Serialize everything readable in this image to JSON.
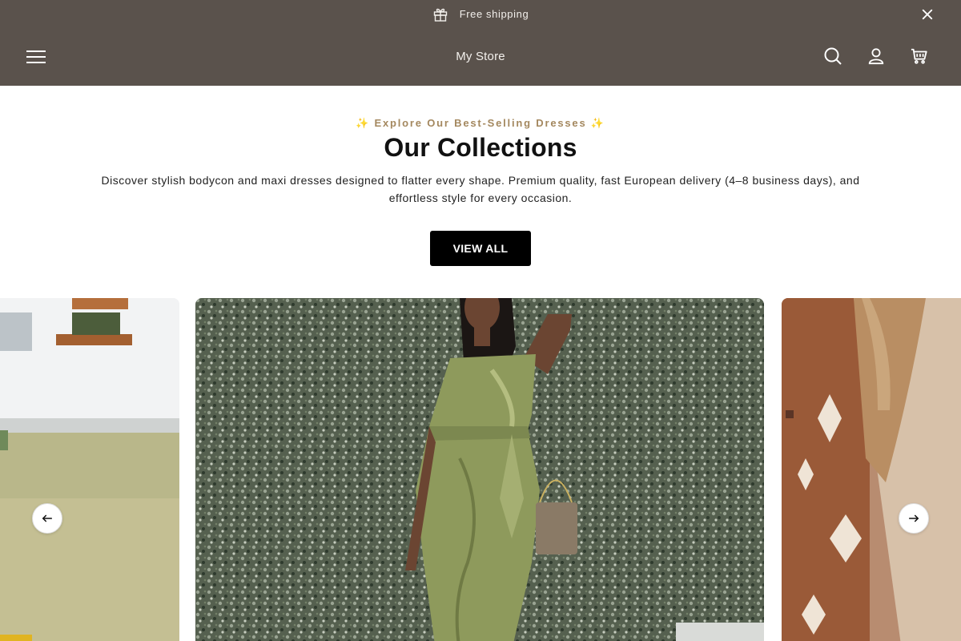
{
  "announcement": {
    "text": "Free shipping",
    "icon": "gift-icon",
    "close_icon": "close-icon"
  },
  "header": {
    "store_name": "My Store",
    "icons": [
      "menu-icon",
      "search-icon",
      "account-icon",
      "cart-icon"
    ],
    "background": "#5a524c"
  },
  "collections": {
    "eyebrow": "✨ Explore Our Best-Selling Dresses ✨",
    "title": "Our Collections",
    "description": "Discover stylish bodycon and maxi dresses designed to flatter every shape. Premium quality, fast European delivery (4–8 business days), and effortless style for every occasion.",
    "button_label": "VIEW ALL"
  },
  "carousel": {
    "slides": [
      {
        "name": "slide-previous",
        "image": "woman-in-yellow-dress-on-lawn"
      },
      {
        "name": "slide-current",
        "image": "woman-in-olive-satin-one-shoulder-dress"
      },
      {
        "name": "slide-next",
        "image": "brown-aztec-print-dress"
      }
    ],
    "prev_icon": "arrow-left-icon",
    "next_icon": "arrow-right-icon"
  },
  "colors": {
    "accent": "#a4885f",
    "button": "#000000",
    "bar": "#5a524c"
  }
}
